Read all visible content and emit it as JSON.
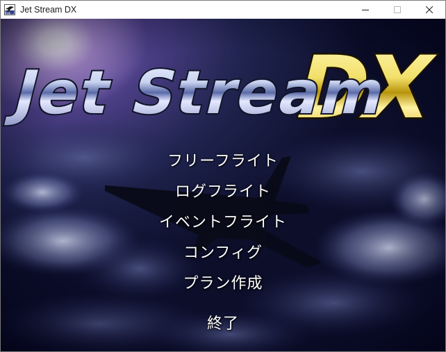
{
  "window": {
    "title": "Jet Stream DX",
    "controls": {
      "minimize": "minimize-icon",
      "maximize": "maximize-icon",
      "close": "close-icon"
    }
  },
  "logo": {
    "text_main": "Jet Stream",
    "text_accent": "DX",
    "colors": {
      "chrome": "#c9d3f0",
      "chrome_dark": "#3a4a86",
      "gold": "#f2e06a",
      "gold_dark": "#8a6d00"
    }
  },
  "menu": {
    "items": [
      {
        "label": "フリーフライト"
      },
      {
        "label": "ログフライト"
      },
      {
        "label": "イベントフライト"
      },
      {
        "label": "コンフィグ"
      },
      {
        "label": "プラン作成"
      },
      {
        "label": "終了"
      }
    ]
  },
  "colors": {
    "sky_dark": "#0c0e2a",
    "sky_mid": "#2a3168",
    "cloud": "#c8cde0",
    "sun": "#ffffff"
  }
}
